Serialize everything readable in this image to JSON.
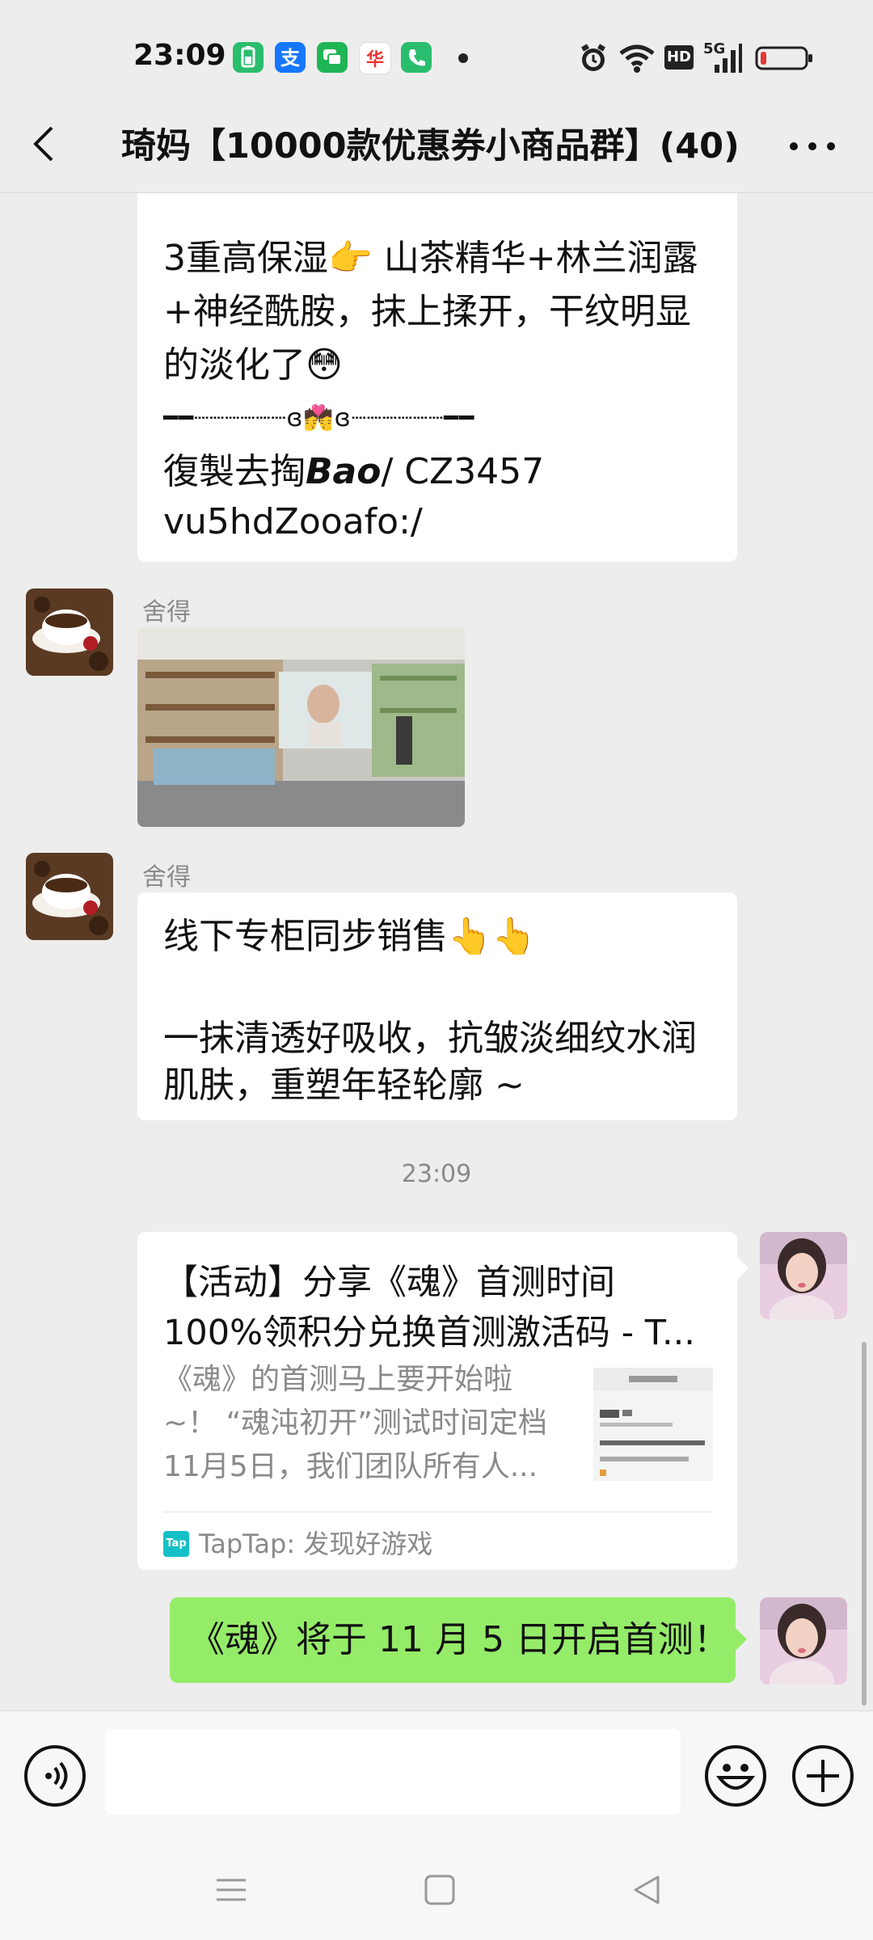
{
  "status_bar": {
    "time": "23:09",
    "apps": [
      "battery-app-icon",
      "alipay-icon",
      "message-icon",
      "app-icon",
      "phone-icon"
    ],
    "network_label": "5G",
    "hd_label": "HD"
  },
  "header": {
    "title": "琦妈【10000款优惠券小商品群】(40)"
  },
  "messages": {
    "first": {
      "line1": "3重高保湿👉 山茶精华+林兰润露",
      "line2": "+神经酰胺，抹上揉开，干纹明显",
      "line3": "的淡化了😳",
      "line4": "━━┈┈┈┈┈┈ɞ💏ɞ┈┈┈┈┈┈━━",
      "line5a": " 復製去掏",
      "line5b": "Bao",
      "line5c": "/ CZ3457",
      "line6": "vu5hdZooafo:/"
    },
    "second": {
      "sender": "舍得"
    },
    "third": {
      "sender": "舍得",
      "line1": "线下专柜同步销售👆👆",
      "line2": "一抹清透好吸收，抗皱淡细纹水润",
      "line3": "肌肤，重塑年轻轮廓 ~"
    },
    "timestamp": "23:09",
    "link_card": {
      "title_line1": "【活动】分享《魂》首测时间",
      "title_line2": "100%领积分兑换首测激活码 - T...",
      "desc_line1": "《魂》的首测马上要开始啦",
      "desc_line2": "~！ “魂沌初开”测试时间定档",
      "desc_line3": "11月5日，我们团队所有人...",
      "source_icon": "Tap",
      "source": "TapTap: 发现好游戏"
    },
    "own": {
      "text": "《魂》将于 11 月 5 日开启首测！"
    }
  },
  "colors": {
    "background": "#ededed",
    "green_bubble": "#95ec69",
    "taptap": "#14c0c6"
  }
}
